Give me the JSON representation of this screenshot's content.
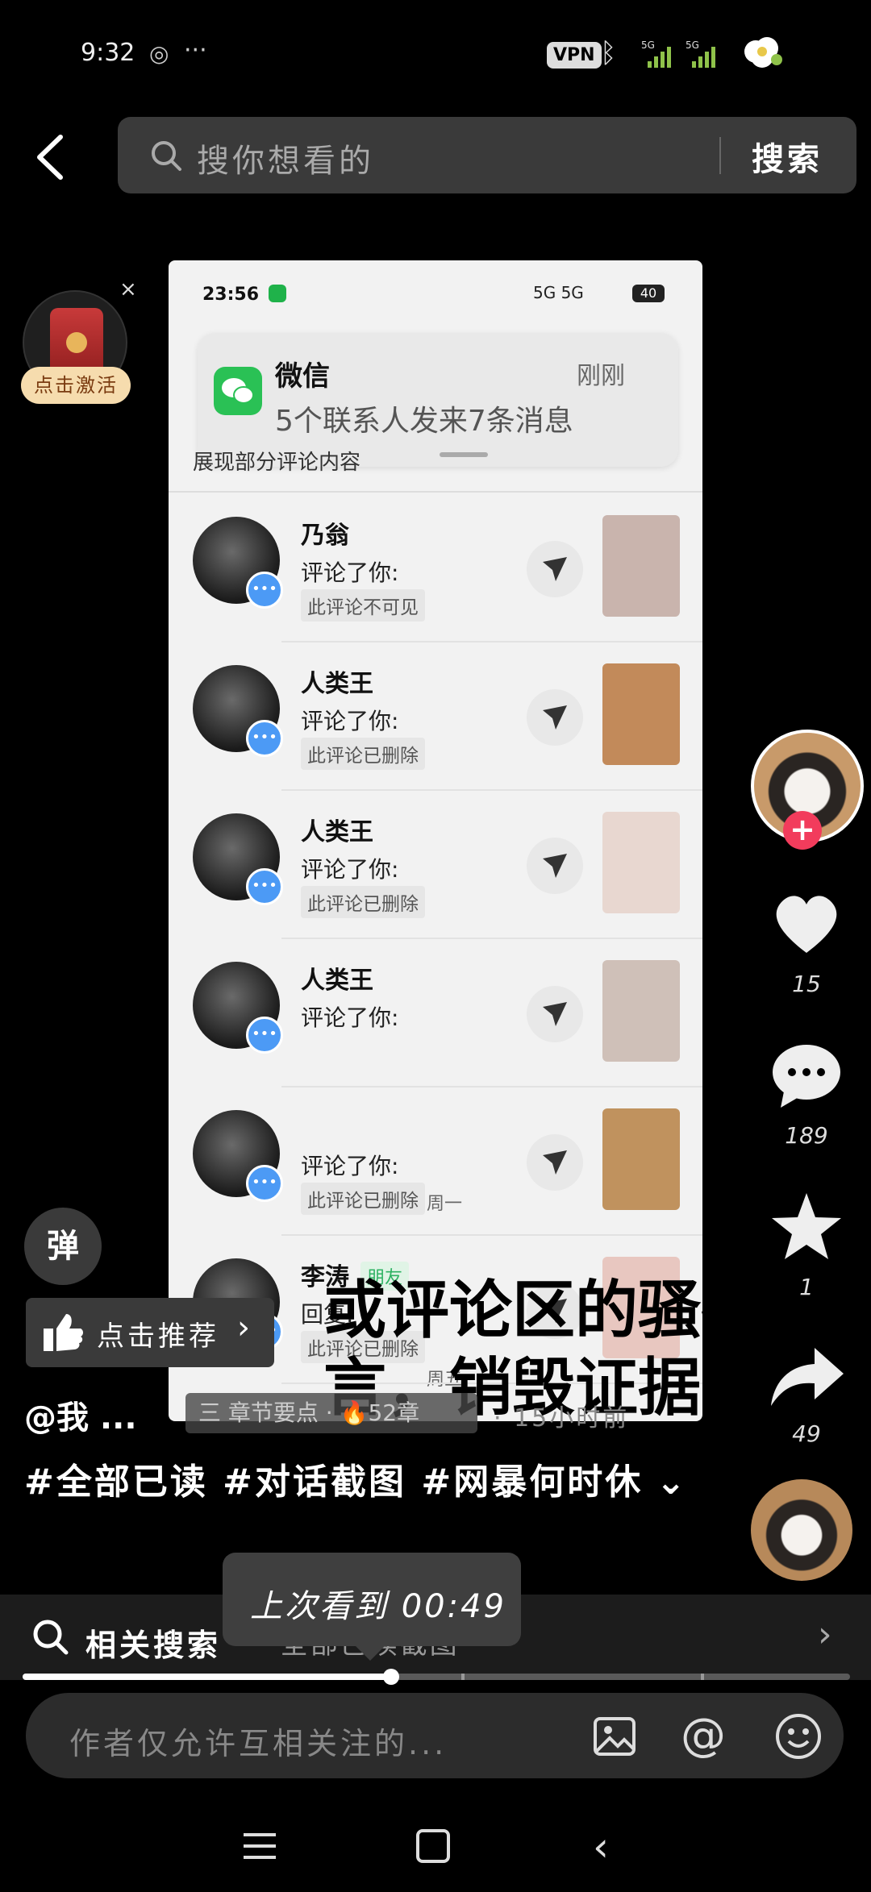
{
  "status_bar": {
    "time": "9:32",
    "vpn_label": "VPN",
    "signal1_label": "5G",
    "signal2_label": "5G"
  },
  "search": {
    "placeholder": "搜你想看的",
    "button_label": "搜索"
  },
  "red_envelope": {
    "label": "点击激活",
    "close_symbol": "×"
  },
  "video_screenshot": {
    "status_time": "23:56",
    "status_right": "5G 5G",
    "battery": "40",
    "notification": {
      "app_name": "微信",
      "time": "刚刚",
      "message": "5个联系人发来7条消息"
    },
    "partial_header": "展现部分评论内容",
    "rows": [
      {
        "name": "乃翁",
        "tag": "",
        "action": "评论了你:",
        "quote": "此评论不可见",
        "meta": ""
      },
      {
        "name": "人类王",
        "tag": "",
        "action": "评论了你:",
        "quote": "此评论已删除",
        "meta": ""
      },
      {
        "name": "人类王",
        "tag": "",
        "action": "评论了你:",
        "quote": "此评论已删除",
        "meta": ""
      },
      {
        "name": "人类王",
        "tag": "",
        "action": "评论了你:",
        "quote": "",
        "meta": ""
      },
      {
        "name": "",
        "tag": "",
        "action": "评论了你:",
        "quote": "此评论已删除",
        "meta": "周一"
      },
      {
        "name": "李涛",
        "tag": "朋友",
        "action": "回复:",
        "quote": "此评论已删除",
        "meta": "周五"
      }
    ],
    "overlay_caption_line1": "或评论区的骚扰留",
    "overlay_caption_line2": "言，销毁证据。"
  },
  "right_rail": {
    "like_count": "15",
    "comment_count": "189",
    "favorite_count": "1",
    "share_count": "49",
    "follow_symbol": "+"
  },
  "danmaku_label": "弹",
  "recommend_label": "点击推荐",
  "author": "@我 ...",
  "chapter_badge": "三 章节要点 · 🔥52章",
  "post_time": "· 15小时前",
  "caption": "#全部已读 #对话截图 #网暴何时休",
  "related_search": {
    "label": "相关搜索",
    "term": "· 全部已读截图"
  },
  "resume_tooltip": "上次看到 00:49",
  "progress": {
    "fraction": 0.445,
    "chapter_ticks": [
      0.04,
      0.53,
      0.82
    ]
  },
  "comment_placeholder": "作者仅允许互相关注的...",
  "colors": {
    "accent_red": "#f23c5c",
    "wechat_green": "#2ac155",
    "badge_blue": "#4c9af5"
  }
}
